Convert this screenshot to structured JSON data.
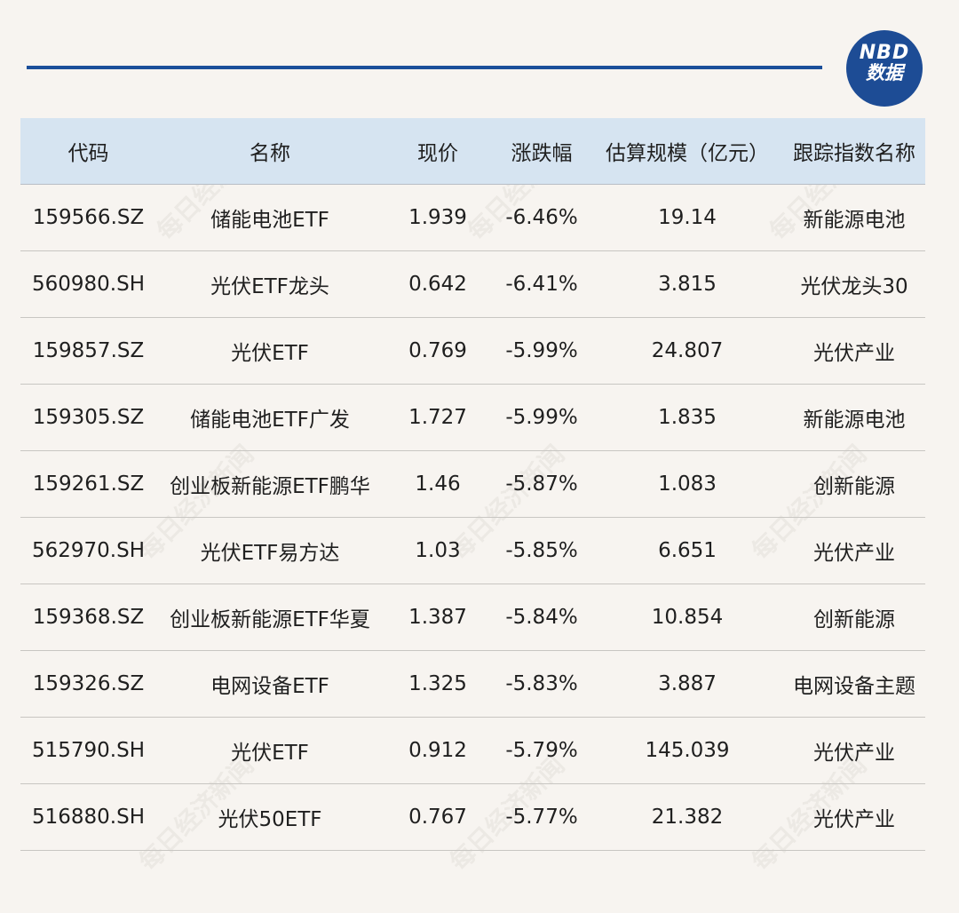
{
  "logo": {
    "line1": "NBD",
    "line2": "数据"
  },
  "watermark_text": "每日经济新闻",
  "table": {
    "headers": [
      "代码",
      "名称",
      "现价",
      "涨跌幅",
      "估算规模（亿元）",
      "跟踪指数名称"
    ],
    "rows": [
      [
        "159566.SZ",
        "储能电池ETF",
        "1.939",
        "-6.46%",
        "19.14",
        "新能源电池"
      ],
      [
        "560980.SH",
        "光伏ETF龙头",
        "0.642",
        "-6.41%",
        "3.815",
        "光伏龙头30"
      ],
      [
        "159857.SZ",
        "光伏ETF",
        "0.769",
        "-5.99%",
        "24.807",
        "光伏产业"
      ],
      [
        "159305.SZ",
        "储能电池ETF广发",
        "1.727",
        "-5.99%",
        "1.835",
        "新能源电池"
      ],
      [
        "159261.SZ",
        "创业板新能源ETF鹏华",
        "1.46",
        "-5.87%",
        "1.083",
        "创新能源"
      ],
      [
        "562970.SH",
        "光伏ETF易方达",
        "1.03",
        "-5.85%",
        "6.651",
        "光伏产业"
      ],
      [
        "159368.SZ",
        "创业板新能源ETF华夏",
        "1.387",
        "-5.84%",
        "10.854",
        "创新能源"
      ],
      [
        "159326.SZ",
        "电网设备ETF",
        "1.325",
        "-5.83%",
        "3.887",
        "电网设备主题"
      ],
      [
        "515790.SH",
        "光伏ETF",
        "0.912",
        "-5.79%",
        "145.039",
        "光伏产业"
      ],
      [
        "516880.SH",
        "光伏50ETF",
        "0.767",
        "-5.77%",
        "21.382",
        "光伏产业"
      ]
    ]
  },
  "colors": {
    "accent_line": "#1b4f9a",
    "logo_bg": "#1d4c95",
    "header_bg": "#d6e4f1",
    "page_bg": "#f7f4f0"
  }
}
